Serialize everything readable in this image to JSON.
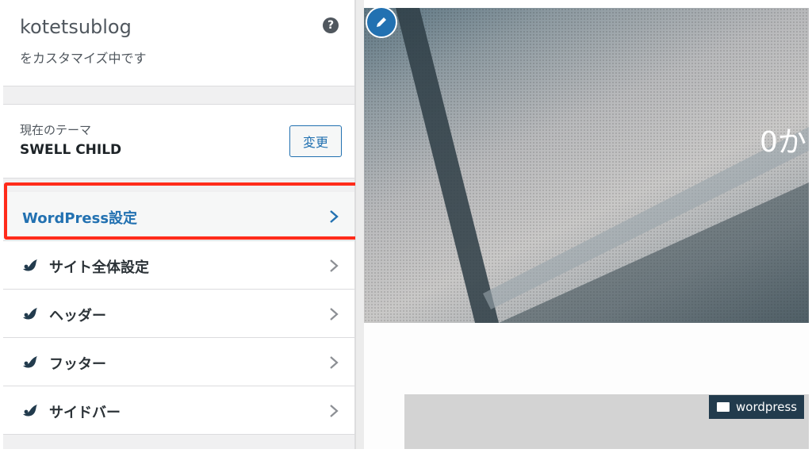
{
  "header": {
    "site_title": "kotetsublog",
    "subtitle": "をカスタマイズ中です",
    "help_icon": "?"
  },
  "theme": {
    "label": "現在のテーマ",
    "name": "SWELL CHILD",
    "change_button": "変更"
  },
  "menu": {
    "items": [
      {
        "label": "WordPress設定",
        "icon": "none",
        "highlighted": true
      },
      {
        "label": "サイト全体設定",
        "icon": "swell-logo-icon"
      },
      {
        "label": "ヘッダー",
        "icon": "swell-logo-icon"
      },
      {
        "label": "フッター",
        "icon": "swell-logo-icon"
      },
      {
        "label": "サイドバー",
        "icon": "swell-logo-icon"
      }
    ]
  },
  "preview": {
    "hero_text": "0か",
    "category_badge": "wordpress"
  },
  "colors": {
    "accent": "#2271b1",
    "highlight_border": "#ff2b1a",
    "badge_bg": "#223b4d"
  }
}
